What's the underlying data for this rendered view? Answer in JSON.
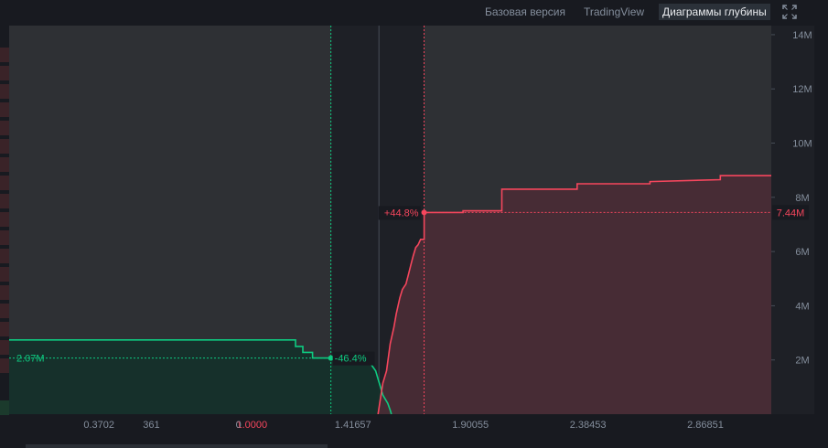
{
  "tabs": [
    {
      "label": "Базовая версия",
      "active": false
    },
    {
      "label": "TradingView",
      "active": false
    },
    {
      "label": "Диаграммы глубины",
      "active": true
    }
  ],
  "icons": {
    "expand": "expand-icon"
  },
  "colors": {
    "bid": "#0ecb81",
    "ask": "#f6465d",
    "bid_fill": "#15312a",
    "ask_fill": "#4a2c35",
    "axis_text": "#848e9c",
    "highlight_left": "#2e3034",
    "highlight_right": "#2e3034"
  },
  "chart_data": {
    "type": "area",
    "y_axis": {
      "ticks": [
        2000000,
        4000000,
        6000000,
        8000000,
        10000000,
        12000000,
        14000000
      ],
      "tick_labels": [
        "2M",
        "4M",
        "6M",
        "8M",
        "10M",
        "12M",
        "14M"
      ],
      "ylim": [
        0,
        14200000
      ]
    },
    "x_axis": {
      "xlim": [
        0.0,
        3.14
      ],
      "tick_values": [
        0.3702,
        0.5861,
        1.0,
        1.41657,
        1.90055,
        2.38453,
        2.86851
      ],
      "tick_labels": [
        "0.3702",
        "361",
        "1.0000",
        "1.41657",
        "1.90055",
        "2.38453",
        "2.86851"
      ],
      "extra_label": "0",
      "extra_label_value": 0.945
    },
    "series": [
      {
        "side": "bid",
        "points": [
          [
            0.0,
            2740000
          ],
          [
            1.18,
            2740000
          ],
          [
            1.18,
            2500000
          ],
          [
            1.21,
            2500000
          ],
          [
            1.21,
            2280000
          ],
          [
            1.25,
            2280000
          ],
          [
            1.25,
            2070000
          ],
          [
            1.45,
            2070000
          ],
          [
            1.45,
            1850000
          ],
          [
            1.49,
            1850000
          ],
          [
            1.51,
            1600000
          ],
          [
            1.52,
            1300000
          ],
          [
            1.53,
            1000000
          ],
          [
            1.54,
            700000
          ],
          [
            1.56,
            400000
          ],
          [
            1.57,
            150000
          ],
          [
            1.575,
            0
          ]
        ]
      },
      {
        "side": "ask",
        "points": [
          [
            1.52,
            0
          ],
          [
            1.53,
            600000
          ],
          [
            1.54,
            1150000
          ],
          [
            1.555,
            1600000
          ],
          [
            1.57,
            2600000
          ],
          [
            1.585,
            3200000
          ],
          [
            1.595,
            3700000
          ],
          [
            1.61,
            4300000
          ],
          [
            1.62,
            4600000
          ],
          [
            1.635,
            4800000
          ],
          [
            1.645,
            5150000
          ],
          [
            1.655,
            5500000
          ],
          [
            1.665,
            5850000
          ],
          [
            1.675,
            6150000
          ],
          [
            1.685,
            6250000
          ],
          [
            1.695,
            6450000
          ],
          [
            1.71,
            6450000
          ],
          [
            1.71,
            7440000
          ],
          [
            1.87,
            7440000
          ],
          [
            1.87,
            7500000
          ],
          [
            2.03,
            7500000
          ],
          [
            2.03,
            8300000
          ],
          [
            2.34,
            8300000
          ],
          [
            2.34,
            8500000
          ],
          [
            2.64,
            8500000
          ],
          [
            2.64,
            8580000
          ],
          [
            2.93,
            8650000
          ],
          [
            2.93,
            8800000
          ],
          [
            3.14,
            8800000
          ]
        ]
      }
    ],
    "reference": {
      "bid_price": 1.3256,
      "bid_amount": 2070000,
      "bid_amount_label": "2.07M",
      "bid_pct_label": "-46.4%",
      "ask_price": 1.7096,
      "ask_amount": 7440000,
      "ask_amount_label": "7.44M",
      "ask_pct_label": "+44.8%",
      "mid_price": 1.5235
    }
  }
}
